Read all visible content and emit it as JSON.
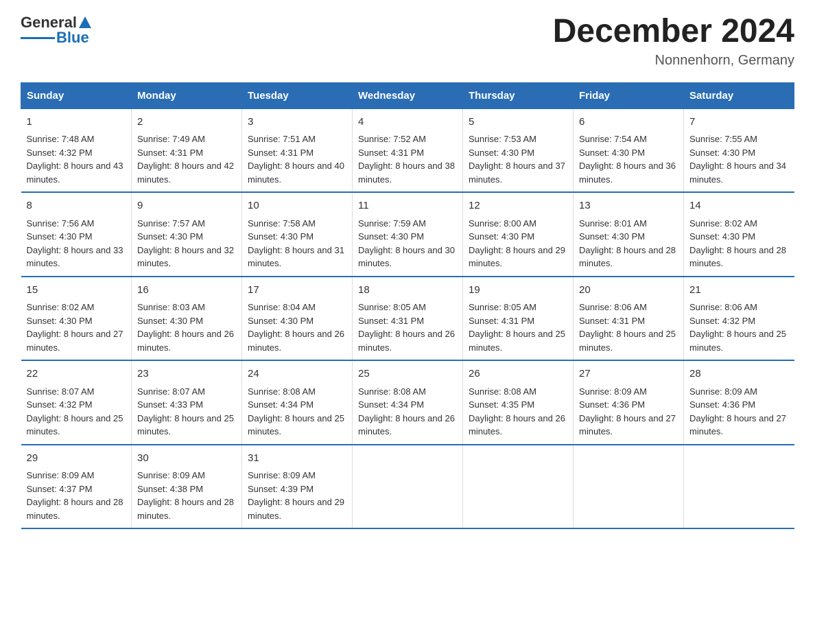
{
  "header": {
    "logo_general": "General",
    "logo_blue": "Blue",
    "month_title": "December 2024",
    "location": "Nonnenhorn, Germany"
  },
  "days_of_week": [
    "Sunday",
    "Monday",
    "Tuesday",
    "Wednesday",
    "Thursday",
    "Friday",
    "Saturday"
  ],
  "weeks": [
    [
      {
        "day": "1",
        "sunrise": "7:48 AM",
        "sunset": "4:32 PM",
        "daylight": "8 hours and 43 minutes."
      },
      {
        "day": "2",
        "sunrise": "7:49 AM",
        "sunset": "4:31 PM",
        "daylight": "8 hours and 42 minutes."
      },
      {
        "day": "3",
        "sunrise": "7:51 AM",
        "sunset": "4:31 PM",
        "daylight": "8 hours and 40 minutes."
      },
      {
        "day": "4",
        "sunrise": "7:52 AM",
        "sunset": "4:31 PM",
        "daylight": "8 hours and 38 minutes."
      },
      {
        "day": "5",
        "sunrise": "7:53 AM",
        "sunset": "4:30 PM",
        "daylight": "8 hours and 37 minutes."
      },
      {
        "day": "6",
        "sunrise": "7:54 AM",
        "sunset": "4:30 PM",
        "daylight": "8 hours and 36 minutes."
      },
      {
        "day": "7",
        "sunrise": "7:55 AM",
        "sunset": "4:30 PM",
        "daylight": "8 hours and 34 minutes."
      }
    ],
    [
      {
        "day": "8",
        "sunrise": "7:56 AM",
        "sunset": "4:30 PM",
        "daylight": "8 hours and 33 minutes."
      },
      {
        "day": "9",
        "sunrise": "7:57 AM",
        "sunset": "4:30 PM",
        "daylight": "8 hours and 32 minutes."
      },
      {
        "day": "10",
        "sunrise": "7:58 AM",
        "sunset": "4:30 PM",
        "daylight": "8 hours and 31 minutes."
      },
      {
        "day": "11",
        "sunrise": "7:59 AM",
        "sunset": "4:30 PM",
        "daylight": "8 hours and 30 minutes."
      },
      {
        "day": "12",
        "sunrise": "8:00 AM",
        "sunset": "4:30 PM",
        "daylight": "8 hours and 29 minutes."
      },
      {
        "day": "13",
        "sunrise": "8:01 AM",
        "sunset": "4:30 PM",
        "daylight": "8 hours and 28 minutes."
      },
      {
        "day": "14",
        "sunrise": "8:02 AM",
        "sunset": "4:30 PM",
        "daylight": "8 hours and 28 minutes."
      }
    ],
    [
      {
        "day": "15",
        "sunrise": "8:02 AM",
        "sunset": "4:30 PM",
        "daylight": "8 hours and 27 minutes."
      },
      {
        "day": "16",
        "sunrise": "8:03 AM",
        "sunset": "4:30 PM",
        "daylight": "8 hours and 26 minutes."
      },
      {
        "day": "17",
        "sunrise": "8:04 AM",
        "sunset": "4:30 PM",
        "daylight": "8 hours and 26 minutes."
      },
      {
        "day": "18",
        "sunrise": "8:05 AM",
        "sunset": "4:31 PM",
        "daylight": "8 hours and 26 minutes."
      },
      {
        "day": "19",
        "sunrise": "8:05 AM",
        "sunset": "4:31 PM",
        "daylight": "8 hours and 25 minutes."
      },
      {
        "day": "20",
        "sunrise": "8:06 AM",
        "sunset": "4:31 PM",
        "daylight": "8 hours and 25 minutes."
      },
      {
        "day": "21",
        "sunrise": "8:06 AM",
        "sunset": "4:32 PM",
        "daylight": "8 hours and 25 minutes."
      }
    ],
    [
      {
        "day": "22",
        "sunrise": "8:07 AM",
        "sunset": "4:32 PM",
        "daylight": "8 hours and 25 minutes."
      },
      {
        "day": "23",
        "sunrise": "8:07 AM",
        "sunset": "4:33 PM",
        "daylight": "8 hours and 25 minutes."
      },
      {
        "day": "24",
        "sunrise": "8:08 AM",
        "sunset": "4:34 PM",
        "daylight": "8 hours and 25 minutes."
      },
      {
        "day": "25",
        "sunrise": "8:08 AM",
        "sunset": "4:34 PM",
        "daylight": "8 hours and 26 minutes."
      },
      {
        "day": "26",
        "sunrise": "8:08 AM",
        "sunset": "4:35 PM",
        "daylight": "8 hours and 26 minutes."
      },
      {
        "day": "27",
        "sunrise": "8:09 AM",
        "sunset": "4:36 PM",
        "daylight": "8 hours and 27 minutes."
      },
      {
        "day": "28",
        "sunrise": "8:09 AM",
        "sunset": "4:36 PM",
        "daylight": "8 hours and 27 minutes."
      }
    ],
    [
      {
        "day": "29",
        "sunrise": "8:09 AM",
        "sunset": "4:37 PM",
        "daylight": "8 hours and 28 minutes."
      },
      {
        "day": "30",
        "sunrise": "8:09 AM",
        "sunset": "4:38 PM",
        "daylight": "8 hours and 28 minutes."
      },
      {
        "day": "31",
        "sunrise": "8:09 AM",
        "sunset": "4:39 PM",
        "daylight": "8 hours and 29 minutes."
      },
      null,
      null,
      null,
      null
    ]
  ],
  "labels": {
    "sunrise": "Sunrise: ",
    "sunset": "Sunset: ",
    "daylight": "Daylight: "
  }
}
